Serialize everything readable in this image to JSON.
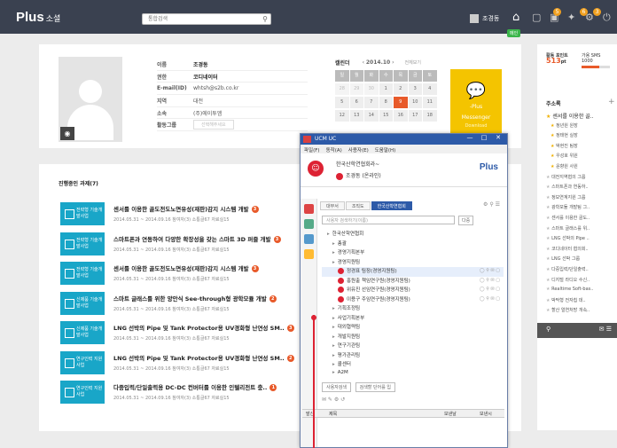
{
  "header": {
    "logo": "Plus",
    "logo_sub": "소셜",
    "search_placeholder": "통합검색",
    "user_name": "조경동",
    "badge_label": "메인",
    "badges": [
      "5",
      "6",
      "3"
    ]
  },
  "profile": {
    "rows": [
      {
        "k": "이름",
        "v": "조경동",
        "bold": true
      },
      {
        "k": "권한",
        "v": "코디네이터",
        "bold": true
      },
      {
        "k": "E-mail(ID)",
        "v": "whtsh@s2b.co.kr"
      },
      {
        "k": "지역",
        "v": "대전"
      },
      {
        "k": "소속",
        "v": "(주)에이투엠"
      },
      {
        "k": "활동그룹",
        "v": "선택해주세요"
      }
    ]
  },
  "calendar": {
    "title": "캘린더",
    "month": "2014.10",
    "today_label": "전체보기",
    "dow": [
      "일",
      "월",
      "화",
      "수",
      "목",
      "금",
      "토"
    ],
    "days": [
      {
        "d": "28",
        "dim": true
      },
      {
        "d": "29",
        "dim": true
      },
      {
        "d": "30",
        "dim": true
      },
      {
        "d": "1"
      },
      {
        "d": "2"
      },
      {
        "d": "3"
      },
      {
        "d": "4"
      },
      {
        "d": "5"
      },
      {
        "d": "6"
      },
      {
        "d": "7"
      },
      {
        "d": "8"
      },
      {
        "d": "9",
        "today": true
      },
      {
        "d": "10"
      },
      {
        "d": "11"
      },
      {
        "d": "12"
      },
      {
        "d": "13"
      },
      {
        "d": "14"
      },
      {
        "d": "15"
      },
      {
        "d": "16"
      },
      {
        "d": "17"
      },
      {
        "d": "18"
      }
    ],
    "messenger": {
      "line1": "-Plus",
      "line2": "Messenger",
      "line3": "Download"
    }
  },
  "tasks": {
    "title": "진행중인 과제(7)",
    "items": [
      {
        "chip": "전략형 기술개발사업",
        "title": "센서를 이용한 골도전도노면유성(재판)감지 시스템 개발",
        "num": "3",
        "meta": "2014.05.31 ~ 2014.09.16   참여자(3)   소통글67   자료실15"
      },
      {
        "chip": "전략형 기술개발사업",
        "title": "스마트폰과 연동하여 다양한 확장성을 갖는 스마트 3D 퍼즐 개발",
        "num": "3",
        "meta": "2014.05.31 ~ 2014.09.16   참여자(3)   소통글67   자료실15"
      },
      {
        "chip": "전략형 기술개발사업",
        "title": "센서를 이용한 골도전도노면유성(재판)감지 시스템 개발",
        "num": "3",
        "meta": "2014.05.31 ~ 2014.09.16   참여자(3)   소통글67   자료실15"
      },
      {
        "chip": "신제품 기술개발사업",
        "title": "스마트 글래스를 위한 양안식 See-through형 광학모듈 개발",
        "num": "2",
        "meta": "2014.05.31 ~ 2014.09.16   참여자(3)   소통글67   자료실15"
      },
      {
        "chip": "신제품 기술개발사업",
        "title": "LNG 선박의 Pipe 및 Tank Protector용 UV경화형 난연성 SM..",
        "num": "3",
        "meta": "2014.05.31 ~ 2014.09.16   참여자(3)   소통글67   자료실15"
      },
      {
        "chip": "연구인력 지원사업",
        "title": "LNG 선박의 Pipe 및 Tank Protector용 UV경화형 난연성 SM..",
        "num": "2",
        "meta": "2014.05.31 ~ 2014.09.16   참여자(3)   소통글67   자료실15"
      },
      {
        "chip": "연구인력 지원사업",
        "title": "다중입력/단일출력용 DC-DC 컨버터를 이용한 인텔리전트 충..",
        "num": "1",
        "meta": "2014.05.31 ~ 2014.09.16   참여자(3)   소통글67   자료실15"
      }
    ]
  },
  "right": {
    "points_label": "활동 포인트",
    "points_value": "513",
    "points_unit": "pt",
    "sms_label": "가용 SMS",
    "sms_value": "1000",
    "fav_title": "주소록",
    "favs": [
      {
        "t": "센서를 이용한 골..",
        "main": true
      },
      {
        "t": "정년원 원장",
        "sub": true
      },
      {
        "t": "정태현 실장",
        "sub": true
      },
      {
        "t": "박현진 팀장",
        "sub": true
      },
      {
        "t": "우성호 위원",
        "sub": true
      },
      {
        "t": "윤향원 사원",
        "sub": true
      },
      {
        "t": "대전지역협의 그룹"
      },
      {
        "t": "스마트폰과 연동하.."
      },
      {
        "t": "정보연계지원 그룹"
      },
      {
        "t": "광학모듈 개발팀 그.."
      },
      {
        "t": "센서를 이용한 골도.."
      },
      {
        "t": "스마트 글래스를 위.."
      },
      {
        "t": "LNG 선박의 Pipe .."
      },
      {
        "t": "코디네이터 협의회.."
      },
      {
        "t": "LNG 선박 그룹"
      },
      {
        "t": "다중입력/단일출력.."
      },
      {
        "t": "디지털 라디오 수신.."
      },
      {
        "t": "Realtime Soft-bas.."
      },
      {
        "t": "박막형 전자칩 데.."
      },
      {
        "t": "할산 얼연처방 개속.."
      }
    ]
  },
  "ucm": {
    "title": "UCM UC",
    "menu": [
      "파일(F)",
      "동작(A)",
      "사용자(E)",
      "도움말(H)"
    ],
    "org": "한국산학연협회라~",
    "me": "조경동 (온라인)",
    "brand": "Plus",
    "tabs": [
      "대부서",
      "조직도",
      "한국산학연협회"
    ],
    "search_placeholder": "사용자 검색하기(이름)",
    "search_opt": "다중",
    "tree": [
      {
        "t": "한국산학연협회",
        "lvl": 0
      },
      {
        "t": "총괄",
        "lvl": 1
      },
      {
        "t": "경영기획본부",
        "lvl": 1
      },
      {
        "t": "경영지원팀",
        "lvl": 1
      },
      {
        "t": "정경표 팀장(경영지원팀)",
        "lvl": 2,
        "sel": true,
        "p": true
      },
      {
        "t": "홍원출 책임연구원(경영지원팀)",
        "lvl": 2,
        "p": true
      },
      {
        "t": "위유진 선임연구원(경영지원팀)",
        "lvl": 2,
        "p": true
      },
      {
        "t": "이용구 주임연구원(경영지원팀)",
        "lvl": 2,
        "p": true
      },
      {
        "t": "기획조정팀",
        "lvl": 1
      },
      {
        "t": "사업기획본부",
        "lvl": 1
      },
      {
        "t": "대외협력팀",
        "lvl": 1
      },
      {
        "t": "개발지원팀",
        "lvl": 1
      },
      {
        "t": "연구기관팀",
        "lvl": 1
      },
      {
        "t": "평가관리팀",
        "lvl": 1
      },
      {
        "t": "콜센터",
        "lvl": 1
      },
      {
        "t": "A2M",
        "lvl": 1
      }
    ],
    "bottom_select": "사용자검색",
    "bottom_search": "검색할 단어를 입",
    "cols": [
      "발신",
      "제목",
      "보낸날",
      "보낸시"
    ]
  }
}
